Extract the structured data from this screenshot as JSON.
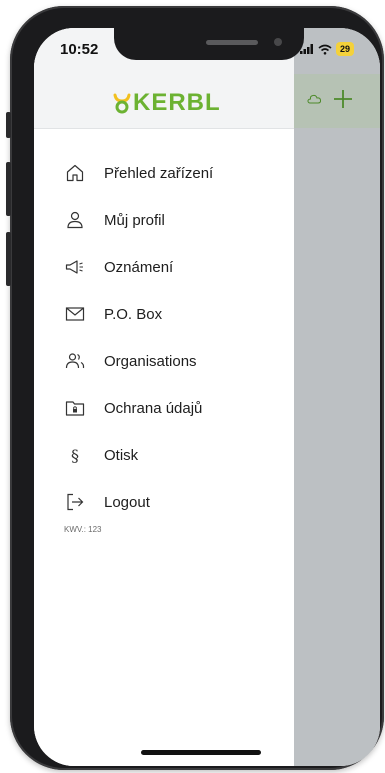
{
  "status_bar": {
    "time": "10:52",
    "battery": "29"
  },
  "header": {
    "logo_text": "KERBL"
  },
  "menu": {
    "items": [
      {
        "label": "Přehled zařízení",
        "icon": "home-icon"
      },
      {
        "label": "Můj profil",
        "icon": "user-icon"
      },
      {
        "label": "Oznámení",
        "icon": "megaphone-icon"
      },
      {
        "label": "P.O. Box",
        "icon": "mail-icon"
      },
      {
        "label": "Organisations",
        "icon": "users-icon"
      },
      {
        "label": "Ochrana údajů",
        "icon": "lock-folder-icon"
      },
      {
        "label": "Otisk",
        "icon": "paragraph-icon"
      },
      {
        "label": "Logout",
        "icon": "logout-icon"
      }
    ]
  },
  "version": "KWV.: 123",
  "colors": {
    "brand": "#6cb232",
    "overlay": "#bcc0c3",
    "header": "#f3f4f5"
  }
}
